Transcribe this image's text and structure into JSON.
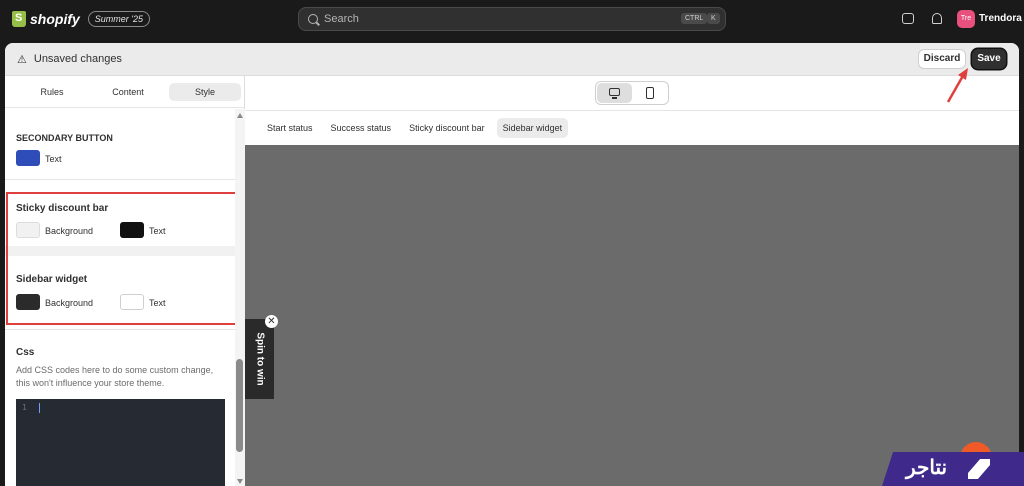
{
  "topbar": {
    "brand": "shopify",
    "edition": "Summer '25",
    "search_placeholder": "Search",
    "kbd_ctrl": "CTRL",
    "kbd_k": "K",
    "avatar_initials": "Tre",
    "store_name": "Trendora"
  },
  "header": {
    "status": "Unsaved changes",
    "discard": "Discard",
    "save": "Save"
  },
  "sidebar": {
    "tabs": [
      "Rules",
      "Content",
      "Style"
    ],
    "active_tab": "Style",
    "secondary_button": {
      "title": "SECONDARY BUTTON",
      "text_label": "Text",
      "text_color": "#2f4db8"
    },
    "sticky_bar": {
      "title": "Sticky discount bar",
      "bg_label": "Background",
      "bg_color": "#f1f1f1",
      "text_label": "Text",
      "text_color": "#111111"
    },
    "sidebar_widget": {
      "title": "Sidebar widget",
      "bg_label": "Background",
      "bg_color": "#2b2b2b",
      "text_label": "Text",
      "text_color": "#ffffff"
    },
    "css": {
      "title": "Css",
      "description": "Add CSS codes here to do some custom change, this won't influence your store theme.",
      "line_number": "1"
    }
  },
  "preview": {
    "tabs": [
      "Start status",
      "Success status",
      "Sticky discount bar",
      "Sidebar widget"
    ],
    "active_tab": "Sidebar widget",
    "widget_label": "Spin to win",
    "close_glyph": "✕"
  },
  "watermark": {
    "text": "نتاجر"
  },
  "colors": {
    "highlight": "#e0403d",
    "canvas": "#6b6b6b",
    "avatar": "#e8507d"
  }
}
